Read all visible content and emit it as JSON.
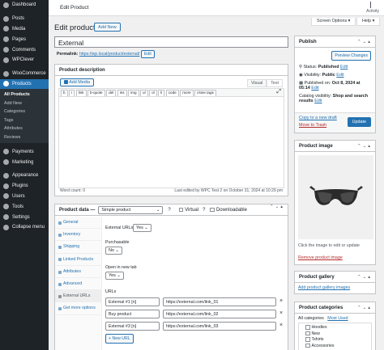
{
  "sidebar": {
    "items": [
      {
        "label": "Dashboard",
        "icon": "dashboard-icon"
      },
      {
        "label": "Posts",
        "icon": "pin-icon"
      },
      {
        "label": "Media",
        "icon": "media-icon"
      },
      {
        "label": "Pages",
        "icon": "page-icon"
      },
      {
        "label": "Comments",
        "icon": "comment-icon"
      },
      {
        "label": "WPClever",
        "icon": "star-icon"
      },
      {
        "label": "WooCommerce",
        "icon": "woo-icon"
      },
      {
        "label": "Products",
        "icon": "archive-icon"
      }
    ],
    "submenu": [
      "All Products",
      "Add New",
      "Categories",
      "Tags",
      "Attributes",
      "Reviews"
    ],
    "items2": [
      {
        "label": "Payments",
        "icon": "card-icon"
      },
      {
        "label": "Marketing",
        "icon": "megaphone-icon"
      },
      {
        "label": "Appearance",
        "icon": "brush-icon"
      },
      {
        "label": "Plugins",
        "icon": "plugin-icon"
      },
      {
        "label": "Users",
        "icon": "user-icon"
      },
      {
        "label": "Tools",
        "icon": "wrench-icon"
      },
      {
        "label": "Settings",
        "icon": "sliders-icon"
      },
      {
        "label": "Collapse menu",
        "icon": "collapse-icon"
      }
    ]
  },
  "topbar": {
    "title": "Edit Product",
    "activity": "Activity"
  },
  "screen_options": "Screen Options ▾",
  "help": "Help ▾",
  "page": {
    "heading": "Edit product",
    "add_new": "Add New"
  },
  "post_title": "External",
  "permalink": {
    "label": "Permalink:",
    "url": "https://wp.local/product/external/",
    "edit": "Edit"
  },
  "description": {
    "heading": "Product description",
    "add_media": "Add Media",
    "tab_visual": "Visual",
    "tab_text": "Text",
    "quicktags": [
      "b",
      "i",
      "link",
      "b-quote",
      "del",
      "ins",
      "img",
      "ul",
      "ol",
      "li",
      "code",
      "more",
      "close tags"
    ],
    "word_count": "Word count: 0",
    "last_edited": "Last edited by WPC Test 2 on October 31, 2024 at 10:29 pm"
  },
  "product_data": {
    "heading": "Product data —",
    "type": "Simple product",
    "virtual": "Virtual",
    "downloadable": "Downloadable",
    "tabs": [
      "General",
      "Inventory",
      "Shipping",
      "Linked Products",
      "Attributes",
      "Advanced",
      "External URLs",
      "Get more options"
    ],
    "external_urls_label": "External URLs",
    "external_urls_value": "Yes",
    "purchasable_label": "Purchasable",
    "purchasable_value": "No",
    "new_tab_label": "Open in new tab",
    "new_tab_value": "Yes",
    "urls_label": "URLs",
    "urls": [
      {
        "name": "External #1 [n]",
        "url": "https://external.com/link_01"
      },
      {
        "name": "Buy product",
        "url": "https://external.com/link_02"
      },
      {
        "name": "External #3 [n]",
        "url": "https://external.com/link_03"
      }
    ],
    "new_url": "+ New URL"
  },
  "publish": {
    "heading": "Publish",
    "preview": "Preview Changes",
    "status_label": "Status:",
    "status_value": "Published",
    "visibility_label": "Visibility:",
    "visibility_value": "Public",
    "published_label": "Published on:",
    "published_value": "Oct 8, 2024 at 05:14",
    "edit": "Edit",
    "catalog": "Catalog visibility:",
    "catalog_value": "Shop and search results",
    "copy": "Copy to a new draft",
    "trash": "Move to Trash",
    "update": "Update"
  },
  "product_image": {
    "heading": "Product image",
    "hint": "Click the image to edit or update",
    "remove": "Remove product image"
  },
  "gallery": {
    "heading": "Product gallery",
    "add": "Add product gallery images"
  },
  "categories": {
    "heading": "Product categories",
    "tab_all": "All categories",
    "tab_used": "Most Used",
    "items": [
      "Hoodies",
      "New",
      "Tshirts",
      "Accessories"
    ]
  }
}
